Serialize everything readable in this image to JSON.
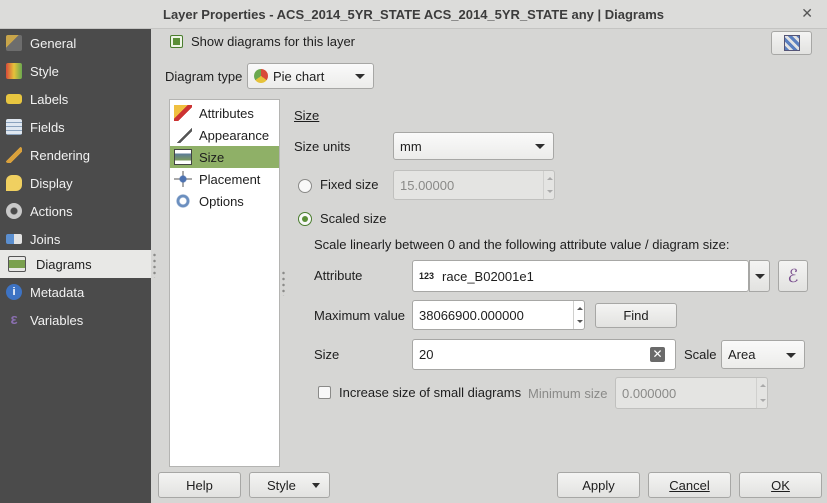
{
  "window": {
    "title": "Layer Properties - ACS_2014_5YR_STATE ACS_2014_5YR_STATE any | Diagrams"
  },
  "sidebar": {
    "items": [
      {
        "label": "General",
        "icon": "general-icon"
      },
      {
        "label": "Style",
        "icon": "style-icon"
      },
      {
        "label": "Labels",
        "icon": "labels-icon"
      },
      {
        "label": "Fields",
        "icon": "fields-icon"
      },
      {
        "label": "Rendering",
        "icon": "rendering-icon"
      },
      {
        "label": "Display",
        "icon": "display-icon"
      },
      {
        "label": "Actions",
        "icon": "actions-icon"
      },
      {
        "label": "Joins",
        "icon": "joins-icon"
      },
      {
        "label": "Diagrams",
        "icon": "diagrams-icon",
        "active": true
      },
      {
        "label": "Metadata",
        "icon": "metadata-icon"
      },
      {
        "label": "Variables",
        "icon": "variables-icon"
      }
    ]
  },
  "main": {
    "show_diagrams_label": "Show diagrams for this layer",
    "diagram_type_label": "Diagram type",
    "diagram_type_value": "Pie chart",
    "tabs": [
      {
        "label": "Attributes"
      },
      {
        "label": "Appearance"
      },
      {
        "label": "Size",
        "active": true
      },
      {
        "label": "Placement"
      },
      {
        "label": "Options"
      }
    ],
    "size": {
      "heading": "Size",
      "size_units_label": "Size units",
      "size_units_value": "mm",
      "fixed_size_label": "Fixed size",
      "fixed_size_value": "15.00000",
      "scaled_size_label": "Scaled size",
      "scale_description": "Scale linearly between 0 and the following attribute value / diagram size:",
      "attribute_label": "Attribute",
      "attribute_type_badge": "123",
      "attribute_value": "race_B02001e1",
      "expression_symbol": "ℰ",
      "max_value_label": "Maximum value",
      "max_value": "38066900.000000",
      "find_label": "Find",
      "size_label": "Size",
      "size_value": "20",
      "scale_label": "Scale",
      "scale_value": "Area",
      "increase_small_label": "Increase size of small diagrams",
      "minimum_size_label": "Minimum size",
      "minimum_size_value": "0.000000"
    }
  },
  "footer": {
    "help": "Help",
    "style": "Style",
    "apply": "Apply",
    "cancel": "Cancel",
    "ok": "OK"
  }
}
